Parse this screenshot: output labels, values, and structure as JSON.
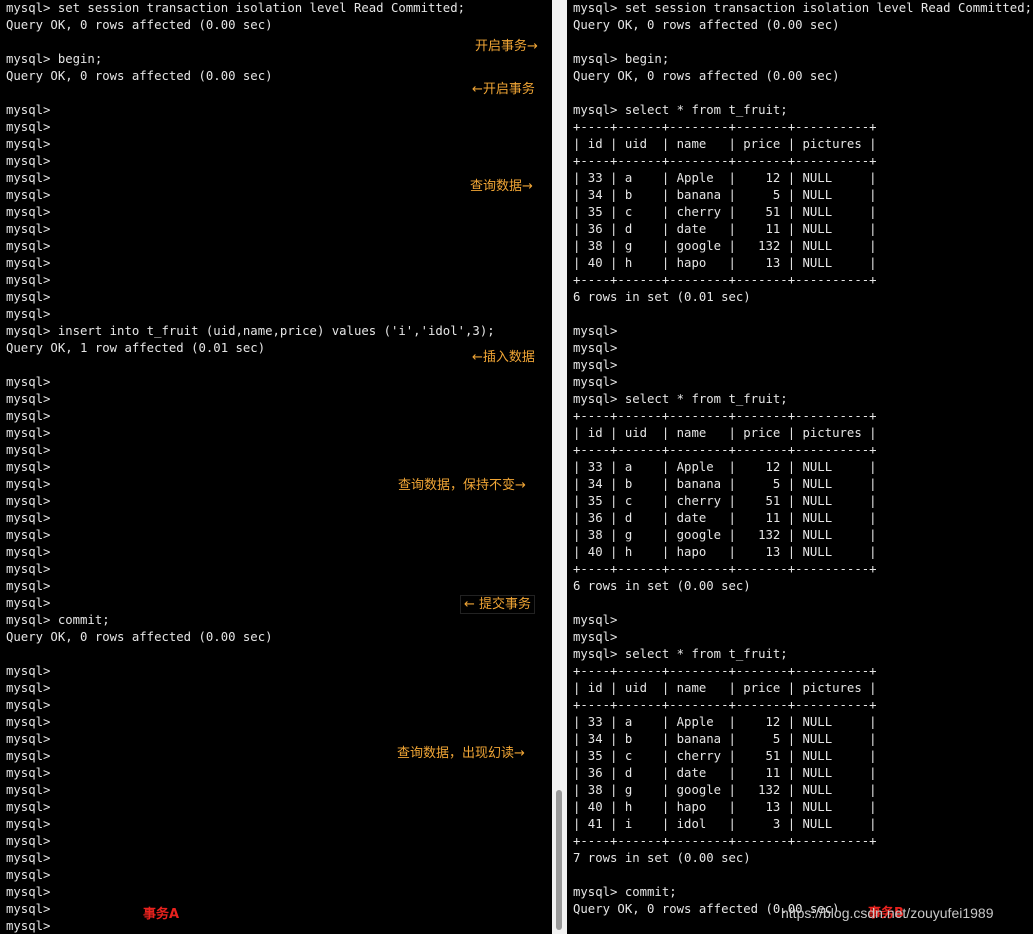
{
  "session_a": {
    "label": "事务A",
    "lines": [
      "mysql> set session transaction isolation level Read Committed;",
      "Query OK, 0 rows affected (0.00 sec)",
      "",
      "mysql> begin;",
      "Query OK, 0 rows affected (0.00 sec)",
      "",
      "mysql>",
      "mysql>",
      "mysql>",
      "mysql>",
      "mysql>",
      "mysql>",
      "mysql>",
      "mysql>",
      "mysql>",
      "mysql>",
      "mysql>",
      "mysql>",
      "mysql>",
      "mysql> insert into t_fruit (uid,name,price) values ('i','idol',3);",
      "Query OK, 1 row affected (0.01 sec)",
      "",
      "mysql>",
      "mysql>",
      "mysql>",
      "mysql>",
      "mysql>",
      "mysql>",
      "mysql>",
      "mysql>",
      "mysql>",
      "mysql>",
      "mysql>",
      "mysql>",
      "mysql>",
      "mysql>",
      "mysql> commit;",
      "Query OK, 0 rows affected (0.00 sec)",
      "",
      "mysql>",
      "mysql>",
      "mysql>",
      "mysql>",
      "mysql>",
      "mysql>",
      "mysql>",
      "mysql>",
      "mysql>",
      "mysql>",
      "mysql>",
      "mysql>",
      "mysql>",
      "mysql>",
      "mysql>",
      "mysql>",
      "mysql>"
    ]
  },
  "session_b": {
    "label": "事务B",
    "lines": [
      "mysql> set session transaction isolation level Read Committed;",
      "Query OK, 0 rows affected (0.00 sec)",
      "",
      "mysql> begin;",
      "Query OK, 0 rows affected (0.00 sec)",
      "",
      "mysql> select * from t_fruit;",
      "+----+------+--------+-------+----------+",
      "| id | uid  | name   | price | pictures |",
      "+----+------+--------+-------+----------+",
      "| 33 | a    | Apple  |    12 | NULL     |",
      "| 34 | b    | banana |     5 | NULL     |",
      "| 35 | c    | cherry |    51 | NULL     |",
      "| 36 | d    | date   |    11 | NULL     |",
      "| 38 | g    | google |   132 | NULL     |",
      "| 40 | h    | hapo   |    13 | NULL     |",
      "+----+------+--------+-------+----------+",
      "6 rows in set (0.01 sec)",
      "",
      "mysql>",
      "mysql>",
      "mysql>",
      "mysql>",
      "mysql> select * from t_fruit;",
      "+----+------+--------+-------+----------+",
      "| id | uid  | name   | price | pictures |",
      "+----+------+--------+-------+----------+",
      "| 33 | a    | Apple  |    12 | NULL     |",
      "| 34 | b    | banana |     5 | NULL     |",
      "| 35 | c    | cherry |    51 | NULL     |",
      "| 36 | d    | date   |    11 | NULL     |",
      "| 38 | g    | google |   132 | NULL     |",
      "| 40 | h    | hapo   |    13 | NULL     |",
      "+----+------+--------+-------+----------+",
      "6 rows in set (0.00 sec)",
      "",
      "mysql>",
      "mysql>",
      "mysql> select * from t_fruit;",
      "+----+------+--------+-------+----------+",
      "| id | uid  | name   | price | pictures |",
      "+----+------+--------+-------+----------+",
      "| 33 | a    | Apple  |    12 | NULL     |",
      "| 34 | b    | banana |     5 | NULL     |",
      "| 35 | c    | cherry |    51 | NULL     |",
      "| 36 | d    | date   |    11 | NULL     |",
      "| 38 | g    | google |   132 | NULL     |",
      "| 40 | h    | hapo   |    13 | NULL     |",
      "| 41 | i    | idol   |     3 | NULL     |",
      "+----+------+--------+-------+----------+",
      "7 rows in set (0.00 sec)",
      "",
      "mysql> commit;",
      "Query OK, 0 rows affected (0.00 sec)"
    ]
  },
  "annotations": {
    "start_txn_b": "开启事务→",
    "start_txn_a": "←开启事务",
    "query_1": "查询数据→",
    "insert": "←插入数据",
    "query_2": "查询数据，保持不变→",
    "commit": "← 提交事务",
    "query_3": "查询数据，出现幻读→"
  },
  "watermark": "https://blog.csdn.net/zouyufei1989",
  "colors": {
    "terminal_bg": "#000000",
    "terminal_text": "#e6e6e6",
    "annotation": "#f0a535",
    "session_label": "#e8221e"
  }
}
